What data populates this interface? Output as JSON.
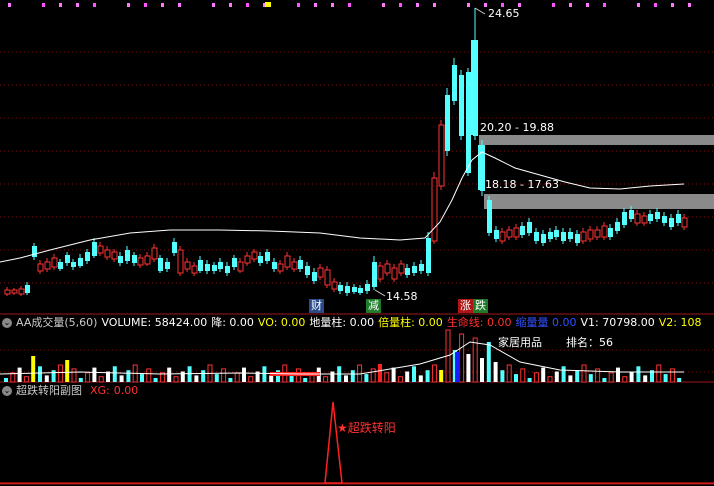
{
  "price_panel": {
    "high_label": "24.65",
    "low_label": "14.58",
    "zone_upper_label": "20.20 - 19.88",
    "zone_lower_label": "18.18 - 17.63",
    "markers": {
      "cai": "财",
      "jian": "减",
      "zhang": "涨",
      "die": "跌"
    }
  },
  "volume_panel": {
    "title": "AA成交量(5,60)",
    "fields": [
      {
        "label": "VOLUME:",
        "value": "58424.00",
        "color": "#ffffff"
      },
      {
        "label": "降:",
        "value": "0.00",
        "color": "#ffffff"
      },
      {
        "label": "VO:",
        "value": "0.00",
        "color": "#ffff00"
      },
      {
        "label": "地量柱:",
        "value": "0.00",
        "color": "#ffffff"
      },
      {
        "label": "倍量柱:",
        "value": "0.00",
        "color": "#ffff00"
      },
      {
        "label": "生命线:",
        "value": "0.00",
        "color": "#ff3030"
      },
      {
        "label": "缩量量",
        "value": "0.00",
        "color": "#3050ff"
      },
      {
        "label": "V1:",
        "value": "70798.00",
        "color": "#ffffff"
      },
      {
        "label": "V2:",
        "value": "108",
        "color": "#ffff00"
      }
    ],
    "sector": "家居用品",
    "rank_label": "排名：",
    "rank_value": "56"
  },
  "signal_panel": {
    "title": "超跌转阳副图",
    "xg_label": "XG:",
    "xg_value": "0.00",
    "signal_text": "★超跌转阳"
  },
  "colors": {
    "up": "#ff3333",
    "down": "#54ffff",
    "ma": "#ffffff",
    "zone": "#8a8a8a",
    "grid": "#7a1010"
  }
}
